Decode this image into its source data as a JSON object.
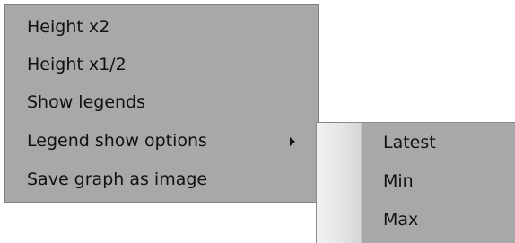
{
  "main_menu": {
    "items": [
      {
        "label": "Height x2"
      },
      {
        "label": "Height x1/2"
      },
      {
        "label": "Show legends"
      },
      {
        "label": "Legend show options",
        "has_submenu": true
      },
      {
        "label": "Save graph as image"
      }
    ]
  },
  "submenu": {
    "items": [
      {
        "label": "Latest"
      },
      {
        "label": "Min"
      },
      {
        "label": "Max"
      }
    ]
  },
  "icons": {
    "submenu_arrow": "chevron-right-icon"
  },
  "colors": {
    "menu_background": "#a8a8a8",
    "text": "#111111"
  }
}
